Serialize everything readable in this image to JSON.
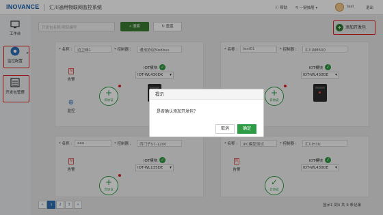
{
  "header": {
    "logo": "INOVANCE",
    "title": "汇川通用物联网监控系统",
    "help": "帮助",
    "one_click": "一键抽屉",
    "user": "test",
    "logout": "退出"
  },
  "sidebar": {
    "items": [
      {
        "label": "工作台"
      },
      {
        "label": "监控配置"
      },
      {
        "label": "开发包管理"
      }
    ]
  },
  "toolbar": {
    "search_placeholder": "开发包名称/项目编号",
    "search_label": "搜索",
    "reset_label": "重置",
    "add_label": "添加开发包"
  },
  "cards": [
    {
      "name_label": "名称",
      "name": "边卫绿1",
      "ctrl_label": "控制器",
      "ctrl": "通用协议Modbus",
      "iot_label": "IOT模块",
      "model": "IOT-WL430DK",
      "alarm": "告警",
      "monitor": "监控",
      "cloud": "云协议"
    },
    {
      "name_label": "名称",
      "name": "test01",
      "ctrl_label": "控制器",
      "ctrl": "汇川AM600",
      "iot_label": "IOT模块",
      "model": "IOT-WL430DE",
      "cloud": "云协议"
    },
    {
      "name_label": "名称",
      "name": "aaa",
      "ctrl_label": "控制器",
      "ctrl": "西门子S7-1200",
      "iot_label": "IOT模块",
      "model": "IOT-WL135DE",
      "alarm": "告警",
      "cloud": "云协议"
    },
    {
      "name_label": "名称",
      "name": "IPC模型测试",
      "ctrl_label": "控制器",
      "ctrl": "汇川H3U",
      "iot_label": "IOT模块",
      "model": "IOT-WL430DE",
      "alarm": "告警",
      "cloud": "云协议"
    }
  ],
  "dialog": {
    "title": "提示",
    "message": "是否确认添加开发包？",
    "cancel": "取消",
    "ok": "确定"
  },
  "pagination": {
    "prev": "«",
    "pages": [
      "1",
      "2",
      "3"
    ],
    "next": "»",
    "info": "显示1 到4 共 9 条记录"
  }
}
